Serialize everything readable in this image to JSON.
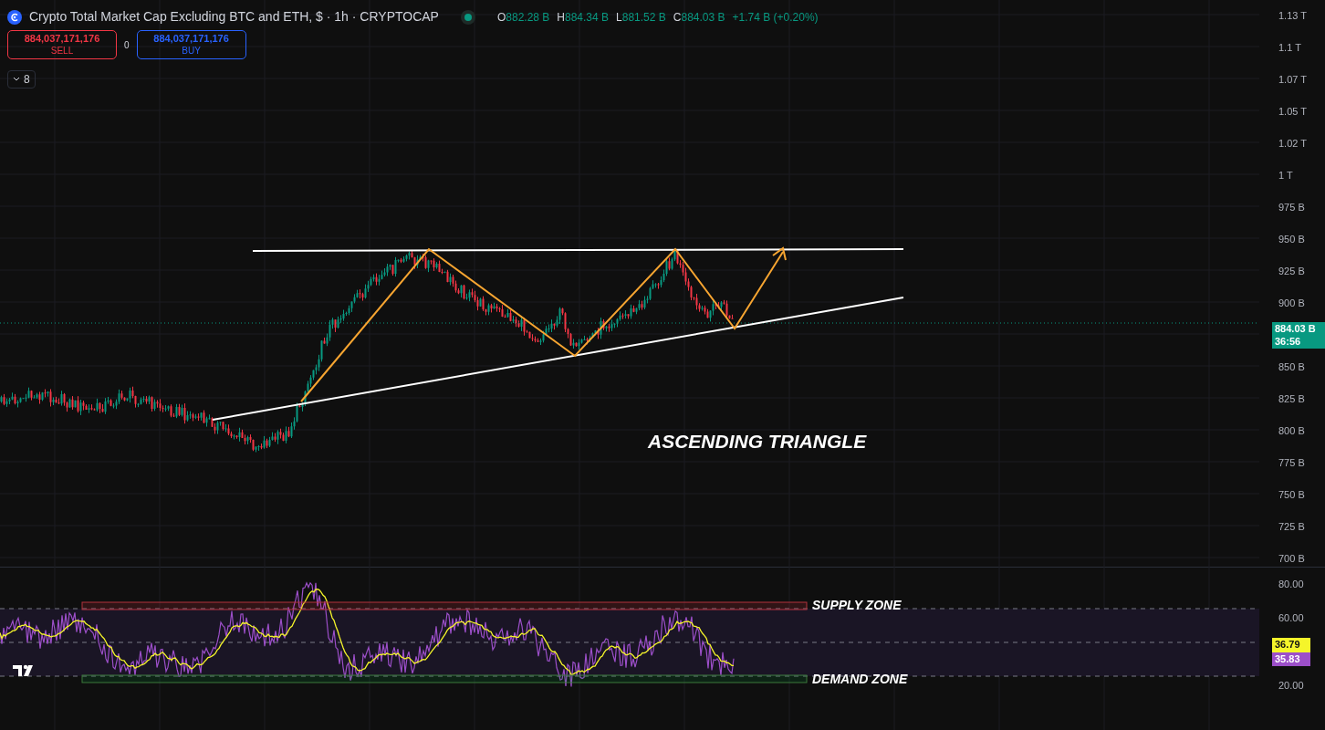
{
  "legend": {
    "title": "Crypto Total Market Cap Excluding BTC and ETH, $ · 1h · CRYPTOCAP",
    "market_open": true,
    "ohlc": [
      {
        "letter": "O",
        "value": "882.28 B"
      },
      {
        "letter": "H",
        "value": "884.34 B"
      },
      {
        "letter": "L",
        "value": "881.52 B"
      },
      {
        "letter": "C",
        "value": "884.03 B"
      }
    ],
    "change": "+1.74 B (+0.20%)"
  },
  "trade": {
    "sell": {
      "price": "884,037,171,176",
      "label": "SELL"
    },
    "spread": "0",
    "buy": {
      "price": "884,037,171,176",
      "label": "BUY"
    }
  },
  "indicators_toggle": {
    "count": "8",
    "expanded": false
  },
  "annotations": [
    {
      "text": "ASCENDING TRIANGLE"
    },
    {
      "text": "SUPPLY ZONE"
    },
    {
      "text": "DEMAND ZONE"
    }
  ],
  "price_axis": [
    {
      "kind": "tick",
      "text": "1.13 T"
    },
    {
      "kind": "tick",
      "text": "1.1 T"
    },
    {
      "kind": "tick",
      "text": "1.07 T"
    },
    {
      "kind": "tick",
      "text": "1.05 T"
    },
    {
      "kind": "tick",
      "text": "1.02 T"
    },
    {
      "kind": "tick",
      "text": "1 T"
    },
    {
      "kind": "tick",
      "text": "975 B"
    },
    {
      "kind": "tick",
      "text": "950 B"
    },
    {
      "kind": "tick",
      "text": "925 B"
    },
    {
      "kind": "tick",
      "text": "900 B"
    },
    {
      "kind": "last_price",
      "price": "884.03 B",
      "countdown": "36:56"
    },
    {
      "kind": "tick",
      "text": "850 B"
    },
    {
      "kind": "tick",
      "text": "825 B"
    },
    {
      "kind": "tick",
      "text": "800 B"
    },
    {
      "kind": "tick",
      "text": "775 B"
    },
    {
      "kind": "tick",
      "text": "750 B"
    },
    {
      "kind": "tick",
      "text": "725 B"
    },
    {
      "kind": "tick",
      "text": "700 B"
    }
  ],
  "rsi_axis": [
    {
      "kind": "tick",
      "text": "80.00"
    },
    {
      "kind": "tick",
      "text": "60.00"
    },
    {
      "kind": "values",
      "items": [
        {
          "text": "36.79",
          "color": "#f5f52a"
        },
        {
          "text": "35.83",
          "color": "#9c4fc9"
        }
      ]
    },
    {
      "kind": "tick",
      "text": "20.00"
    }
  ]
}
